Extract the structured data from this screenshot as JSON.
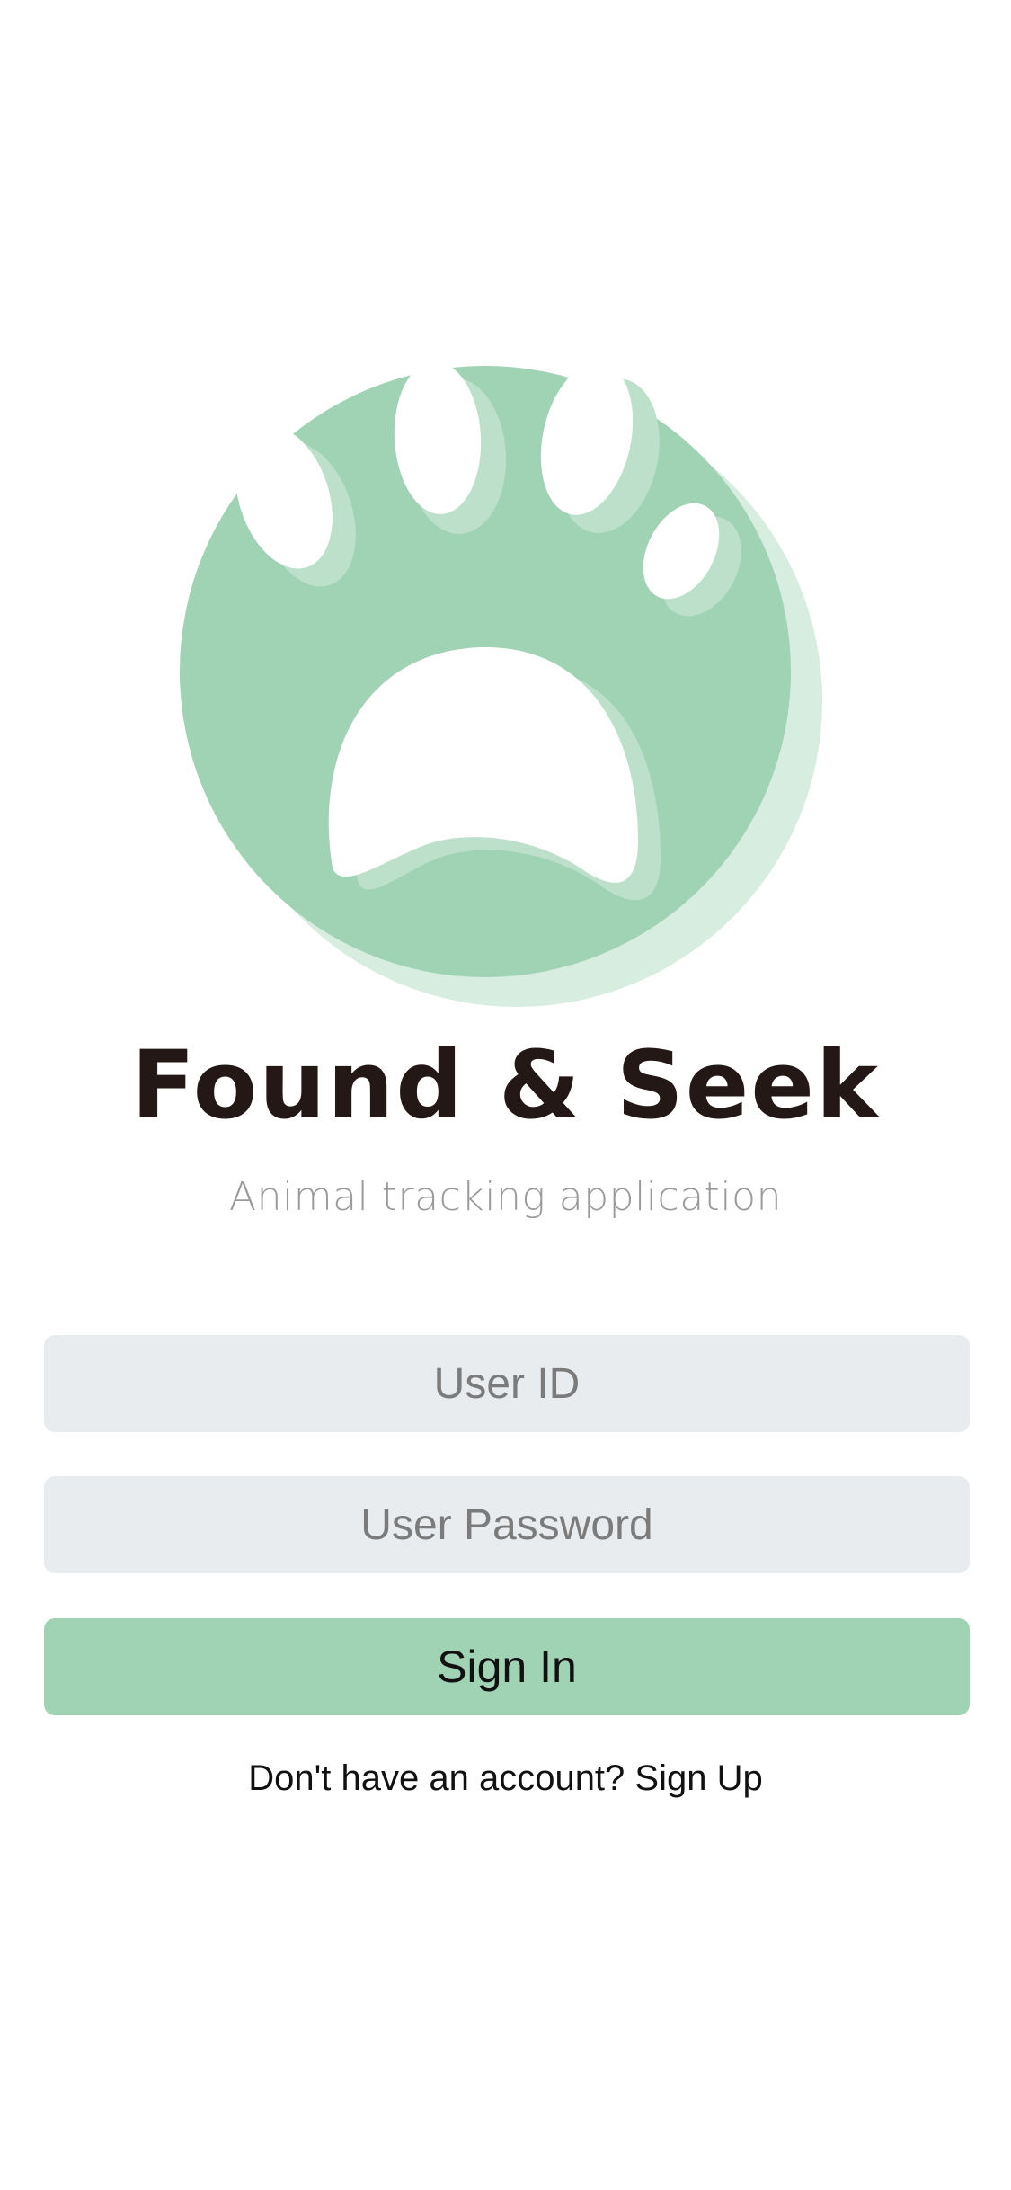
{
  "brand": {
    "name": "Found & Seek",
    "tagline": "Animal tracking application",
    "logo_icon": "paw-print-icon",
    "accent_color": "#a0d2b4"
  },
  "form": {
    "user_id_placeholder": "User ID",
    "user_id_value": "",
    "password_placeholder": "User Password",
    "password_value": "",
    "signin_label": "Sign In"
  },
  "footer": {
    "prompt_text": "Don't have an account?",
    "signup_link": "Sign Up"
  }
}
